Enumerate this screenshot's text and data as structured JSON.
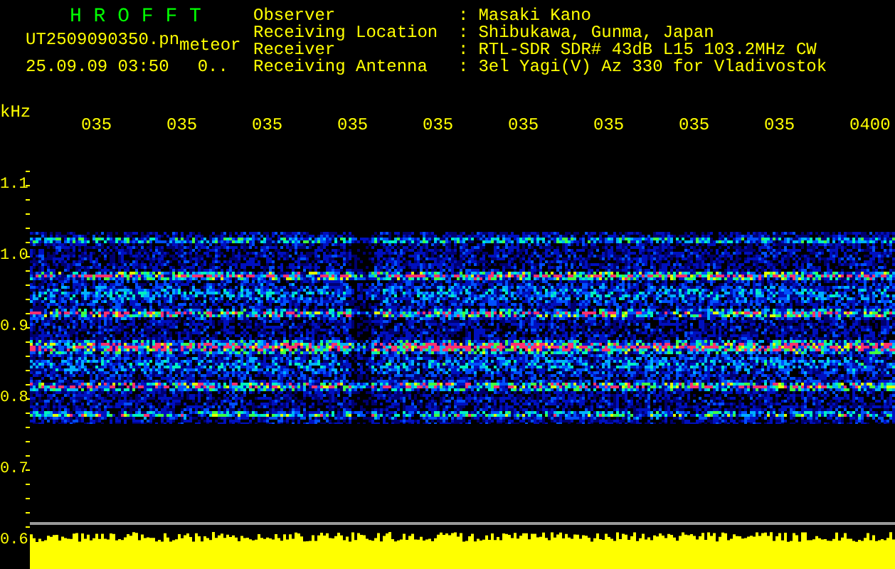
{
  "header": {
    "title": "H R O F F T",
    "filename": "UT2509090350.pn",
    "mode": "meteor",
    "datetime": "25.09.09 03:50",
    "count": "0.."
  },
  "info": [
    {
      "label": "Observer",
      "separator": ":",
      "value": "Masaki Kano"
    },
    {
      "label": "Receiving Location",
      "separator": ":",
      "value": "Shibukawa, Gunma, Japan"
    },
    {
      "label": "Receiver",
      "separator": ":",
      "value": "RTL-SDR SDR# 43dB L15 103.2MHz CW"
    },
    {
      "label": "Receiving Antenna",
      "separator": ":",
      "value": "3el Yagi(V) Az 330 for Vladivostok"
    }
  ],
  "x_axis": {
    "unit": "kHz",
    "labels": [
      "035",
      "035",
      "035",
      "035",
      "035",
      "035",
      "035",
      "035",
      "035",
      "0400"
    ]
  },
  "y_axis": {
    "labels": [
      "1.1",
      "1.0",
      "0.9",
      "0.8",
      "0.7",
      "0.6"
    ]
  }
}
